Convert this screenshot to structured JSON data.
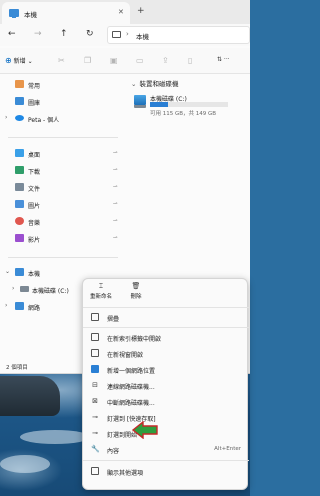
{
  "window": {
    "tab_title": "本機",
    "tab_close": "✕",
    "tab_add": "+"
  },
  "nav": {
    "back": "←",
    "forward": "→",
    "up": "↑",
    "refresh": "↻",
    "address_sep": "›",
    "address_text": "本機"
  },
  "toolbar": {
    "new_plus": "⊕",
    "new_label": "新增",
    "new_caret": "⌄",
    "view_label": "⇅ ···"
  },
  "sidebar": {
    "quick": [
      {
        "label": "常用",
        "icon": "home-icon",
        "color": "#e8954a"
      },
      {
        "label": "圖庫",
        "icon": "gallery-icon",
        "color": "#3a8bd6"
      },
      {
        "label": "Peta - 個人",
        "icon": "onedrive-icon",
        "color": "#1e88e5"
      }
    ],
    "pinned": [
      {
        "label": "桌面",
        "icon": "desktop-icon",
        "color": "#3aa0e8"
      },
      {
        "label": "下載",
        "icon": "download-icon",
        "color": "#2f9e6a"
      },
      {
        "label": "文件",
        "icon": "documents-icon",
        "color": "#7a8a99"
      },
      {
        "label": "圖片",
        "icon": "pictures-icon",
        "color": "#4a90d9"
      },
      {
        "label": "音樂",
        "icon": "music-icon",
        "color": "#e0574f"
      },
      {
        "label": "影片",
        "icon": "videos-icon",
        "color": "#9b4fcf"
      }
    ],
    "pin_glyph": "📌",
    "this_pc": "本機",
    "local_disk": "本機磁碟 (C:)",
    "network": "網路"
  },
  "main": {
    "group_label": "裝置和磁碟機",
    "drive_name": "本機磁碟 (C:)",
    "drive_free": "可用 115 GB，共 149 GB",
    "drive_used_fraction": 0.23
  },
  "status": {
    "text": "2 個項目"
  },
  "context_menu": {
    "rename_label": "重新命名",
    "delete_label": "刪除",
    "items": [
      {
        "label": "摺疊",
        "shortcut": "",
        "icon": "collapse-icon"
      },
      {
        "label": "在新索引標籤中開啟",
        "shortcut": "",
        "icon": "new-tab-icon"
      },
      {
        "label": "在新視窗開啟",
        "shortcut": "",
        "icon": "new-window-icon"
      },
      {
        "label": "新增一個網路位置",
        "shortcut": "",
        "icon": "network-location-icon"
      },
      {
        "label": "連線網路磁碟機...",
        "shortcut": "",
        "icon": "map-drive-icon"
      },
      {
        "label": "中斷網路磁碟機...",
        "shortcut": "",
        "icon": "disconnect-drive-icon"
      },
      {
        "label": "釘選到 [快速存取]",
        "shortcut": "",
        "icon": "pin-icon"
      },
      {
        "label": "釘選到開始",
        "shortcut": "",
        "icon": "pin-start-icon"
      },
      {
        "label": "內容",
        "shortcut": "Alt+Enter",
        "icon": "properties-icon"
      },
      {
        "label": "顯示其他選項",
        "shortcut": "",
        "icon": "more-options-icon"
      }
    ]
  },
  "colors": {
    "accent": "#0067c0",
    "arrow": "#2e9e3e",
    "arrow_outline": "#c62828"
  }
}
